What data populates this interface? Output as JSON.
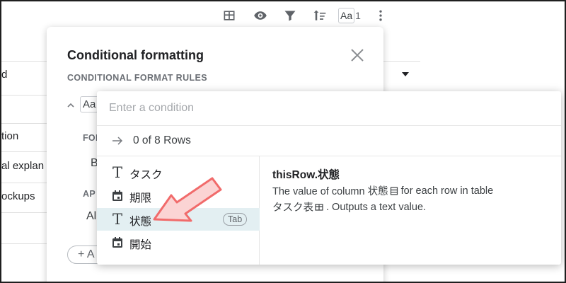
{
  "toolbar": {
    "icons": [
      "table-icon",
      "eye-icon",
      "filter-icon",
      "sort-icon",
      "text-format-icon",
      "more-vert-icon"
    ],
    "aa_label": "Aa",
    "aa_count": "1"
  },
  "background_table": {
    "rows": [
      {
        "text": "d"
      },
      {
        "text": "tion"
      },
      {
        "text": "al explan"
      },
      {
        "text": "ockups"
      }
    ]
  },
  "conditional_formatting": {
    "title": "Conditional formatting",
    "subtitle": "CONDITIONAL FORMAT RULES",
    "rule_style_label": "Aa",
    "for_label": "FOI",
    "for_value": "B",
    "apply_label": "AP",
    "apply_value": "Al",
    "add_button": "+ A",
    "colors": {
      "accent": "#e3eff2",
      "arrow": "#f16b6b"
    }
  },
  "autocomplete": {
    "placeholder": "Enter a condition",
    "input_value": "",
    "rows_summary": "0 of 8 Rows",
    "items": [
      {
        "icon": "text-type-icon",
        "label": "タスク",
        "selected": false
      },
      {
        "icon": "calendar-icon",
        "label": "期限",
        "selected": false
      },
      {
        "icon": "text-type-icon",
        "label": "状態",
        "selected": true,
        "hint": "Tab"
      },
      {
        "icon": "calendar-icon",
        "label": "開始",
        "selected": false
      }
    ],
    "detail": {
      "title": "thisRow.状態",
      "line1_prefix": "The value of column 状態",
      "line1_suffix": "for each row in table",
      "line2_prefix": "タスク表",
      "line2_suffix": ". Outputs a text value."
    }
  }
}
